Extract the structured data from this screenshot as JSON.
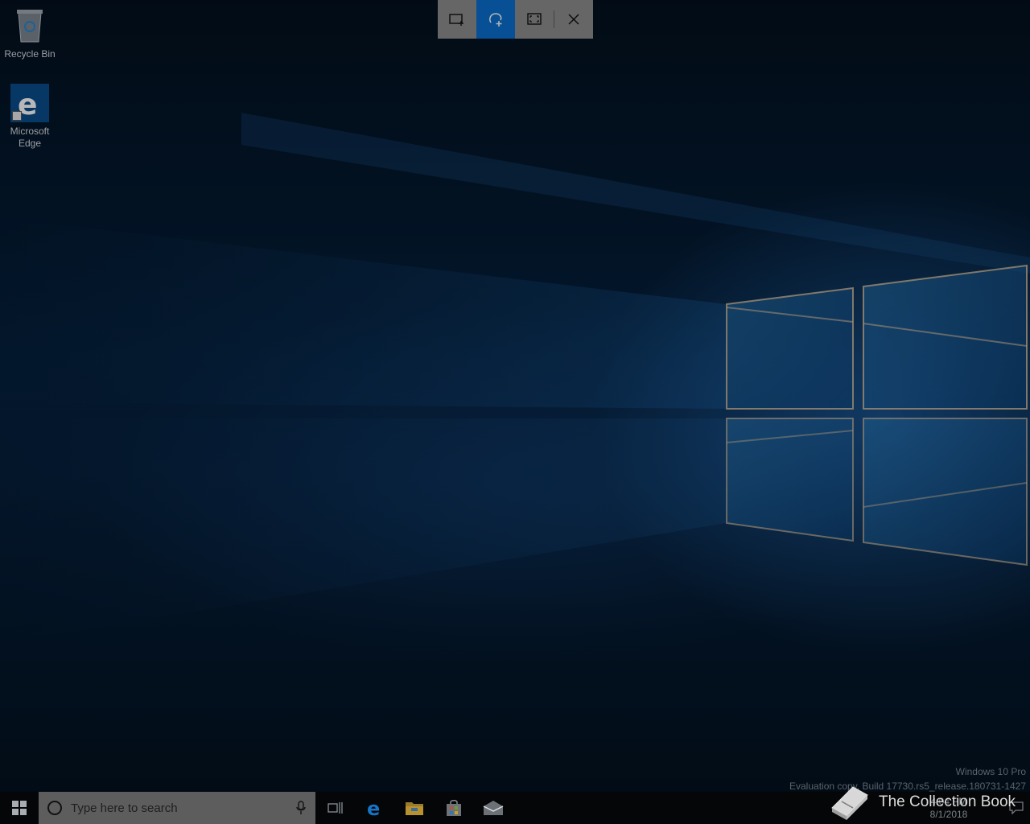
{
  "desktop": {
    "icons": [
      {
        "label": "Recycle Bin"
      },
      {
        "label": "Microsoft Edge"
      }
    ]
  },
  "snip_toolbar": {
    "buttons": [
      {
        "icon": "rectangular-snip-icon",
        "active": false
      },
      {
        "icon": "freeform-snip-icon",
        "active": true
      },
      {
        "icon": "fullscreen-snip-icon",
        "active": false
      },
      {
        "icon": "close-icon",
        "active": false
      }
    ]
  },
  "watermark": {
    "line1": "Windows 10 Pro",
    "line2": "Evaluation copy. Build 17730.rs5_release.180731-1427"
  },
  "taskbar": {
    "search_placeholder": "Type here to search",
    "pinned": [
      "task-view-icon",
      "edge-icon",
      "file-explorer-icon",
      "store-icon",
      "mail-icon"
    ],
    "clock_time": "4:04 PM",
    "clock_date": "8/1/2018"
  },
  "branding": {
    "text": "The Collection Book"
  },
  "colors": {
    "active_blue": "#0b6fd0",
    "toolbar_gray": "#8e8e8e",
    "taskbar": "#050607"
  }
}
